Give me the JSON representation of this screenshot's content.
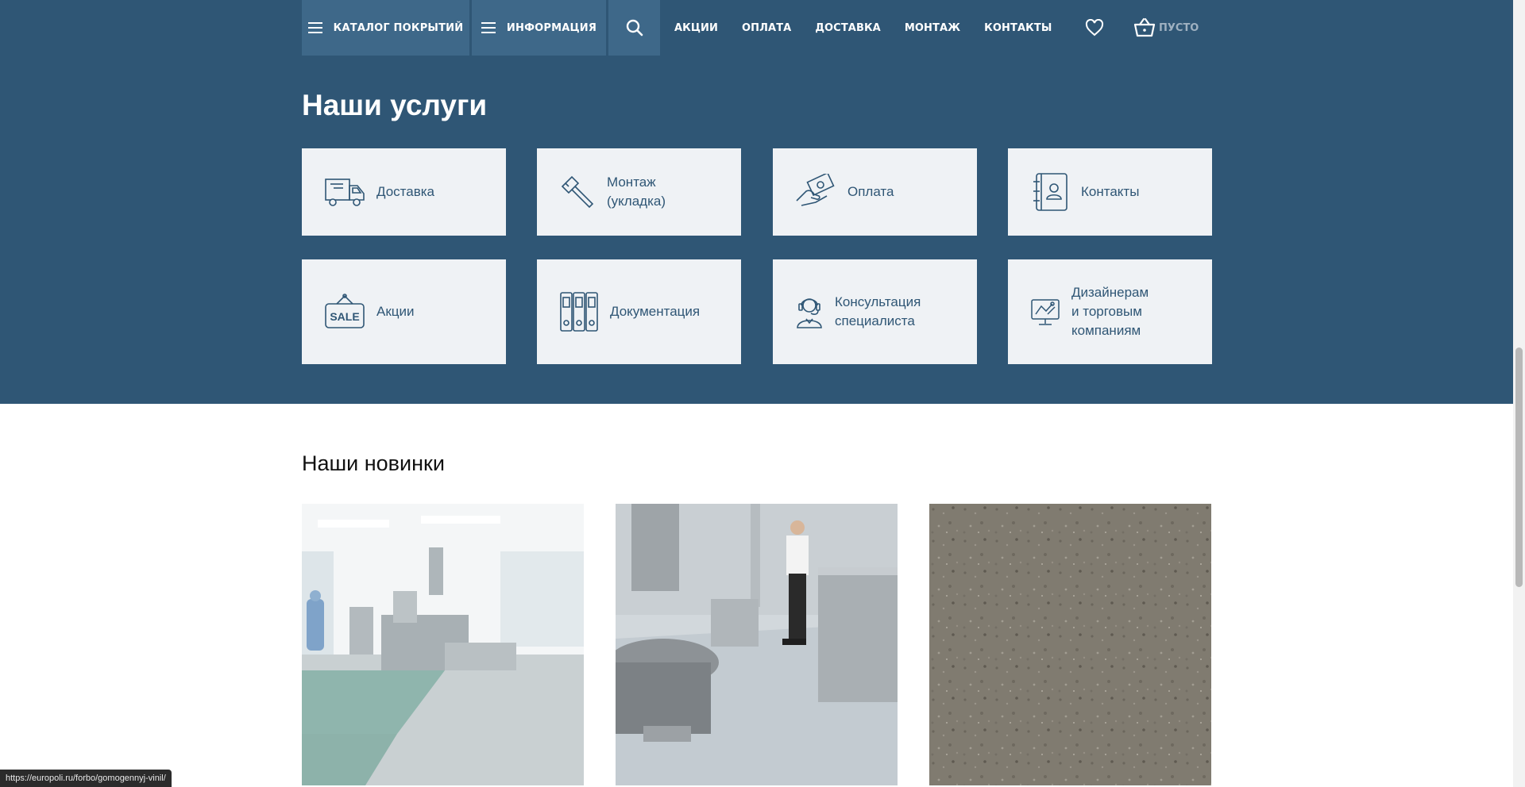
{
  "nav": {
    "catalog_label": "КАТАЛОГ ПОКРЫТИЙ",
    "info_label": "ИНФОРМАЦИЯ",
    "links": [
      "АКЦИИ",
      "ОПЛАТА",
      "ДОСТАВКА",
      "МОНТАЖ",
      "КОНТАКТЫ"
    ],
    "cart_label": "ПУСТО"
  },
  "services": {
    "title": "Наши услуги",
    "items": [
      {
        "label": "Доставка",
        "icon": "truck-icon"
      },
      {
        "label": "Монтаж\n(укладка)",
        "icon": "hammer-icon"
      },
      {
        "label": "Оплата",
        "icon": "payment-hand-icon"
      },
      {
        "label": "Контакты",
        "icon": "contact-book-icon"
      },
      {
        "label": "Акции",
        "icon": "sale-sign-icon"
      },
      {
        "label": "Документация",
        "icon": "binders-icon"
      },
      {
        "label": "Консультация\nспециалиста",
        "icon": "support-agent-icon"
      },
      {
        "label": "Дизайнерам\nи торговым\nкомпаниям",
        "icon": "designer-monitor-icon"
      }
    ]
  },
  "news": {
    "title": "Наши новинки",
    "products": [
      {
        "image": "pharma-production-floor-image"
      },
      {
        "image": "industrial-kitchen-floor-image"
      },
      {
        "image": "gray-speckled-vinyl-texture-image"
      }
    ]
  },
  "status_url": "https://europoli.ru/forbo/gomogennyj-vinil/",
  "colors": {
    "brand_blue": "#2f5675",
    "nav_button": "#3e6889",
    "card_bg": "#eff2f5"
  }
}
